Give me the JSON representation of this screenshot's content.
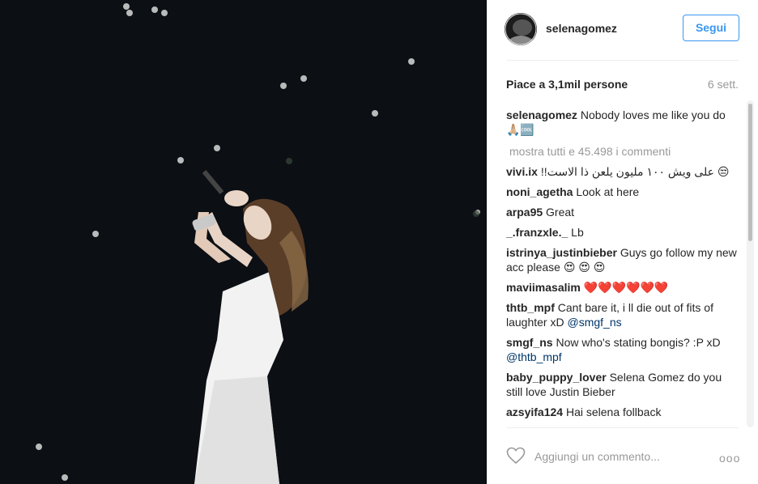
{
  "post": {
    "username": "selenagomez",
    "follow_label": "Segui",
    "likes": "Piace a 3,1mil persone",
    "time": "6 sett.",
    "caption": {
      "user": "selenagomez",
      "text": "Nobody loves me like you do 🙏🏼🆒"
    },
    "show_all": "mostra tutti e 45.498 i commenti",
    "comments": [
      {
        "user": "vivi.ix",
        "text": "!!على ويش ١٠٠ مليون يلعن ذا الاست 😒"
      },
      {
        "user": "noni_agetha",
        "text": "Look at here"
      },
      {
        "user": "arpa95",
        "text": "Great"
      },
      {
        "user": "_.franzxle._",
        "text": "Lb"
      },
      {
        "user": "istrinya_justinbieber",
        "text": "Guys go follow my new acc please 😍 😍 😍"
      },
      {
        "user": "maviimasalim",
        "text": "❤️❤️❤️❤️❤️❤️"
      },
      {
        "user": "thtb_mpf",
        "text": "Cant bare it, i ll die out of fits of laughter xD ",
        "mention": "@smgf_ns"
      },
      {
        "user": "smgf_ns",
        "text": "Now who's stating bongis? :P xD ",
        "mention": "@thtb_mpf"
      },
      {
        "user": "baby_puppy_lover",
        "text": "Selena Gomez do you still love Justin Bieber"
      },
      {
        "user": "azsyifa124",
        "text": "Hai selena follback"
      }
    ],
    "add_comment_placeholder": "Aggiungi un commento...",
    "more": "ooo"
  },
  "icons": {
    "like": "heart-outline-icon",
    "more": "ellipsis-icon"
  },
  "colors": {
    "accent": "#3897f0",
    "muted": "#999999",
    "photo_bg": "#0c0f14"
  }
}
